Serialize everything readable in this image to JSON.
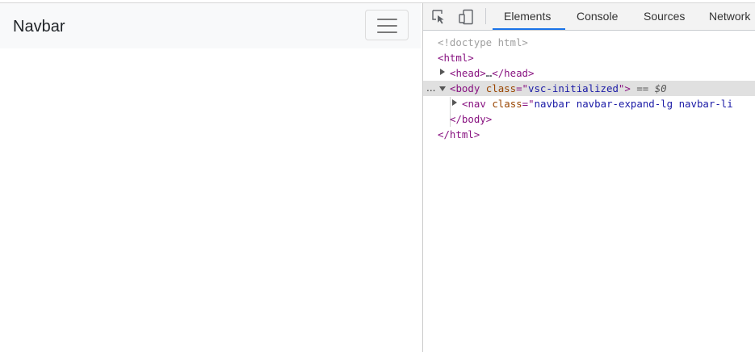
{
  "page": {
    "navbar": {
      "brand": "Navbar",
      "toggler_icon": "hamburger-icon"
    }
  },
  "devtools": {
    "toolbar": {
      "inspect_icon": "inspect-element-icon",
      "device_icon": "device-toggle-icon",
      "tabs": [
        "Elements",
        "Console",
        "Sources",
        "Network"
      ],
      "active_tab": "Elements",
      "accent_color": "#1a73e8"
    },
    "dom": {
      "doctype": "<!doctype html>",
      "html_open": "<html>",
      "head_open": "<head>",
      "head_ellipsis": "…",
      "head_close": "</head>",
      "body_open": "<body",
      "body_attr_name": "class",
      "body_attr_eq": "=\"",
      "body_attr_value": "vsc-initialized",
      "body_attr_close": "\">",
      "selected_marker": "== $0",
      "selected_dots": "...",
      "nav_open": "<nav",
      "nav_attr_name": "class",
      "nav_attr_eq": "=\"",
      "nav_attr_value": "navbar navbar-expand-lg navbar-li",
      "body_close": "</body>",
      "html_close": "</html>"
    }
  }
}
